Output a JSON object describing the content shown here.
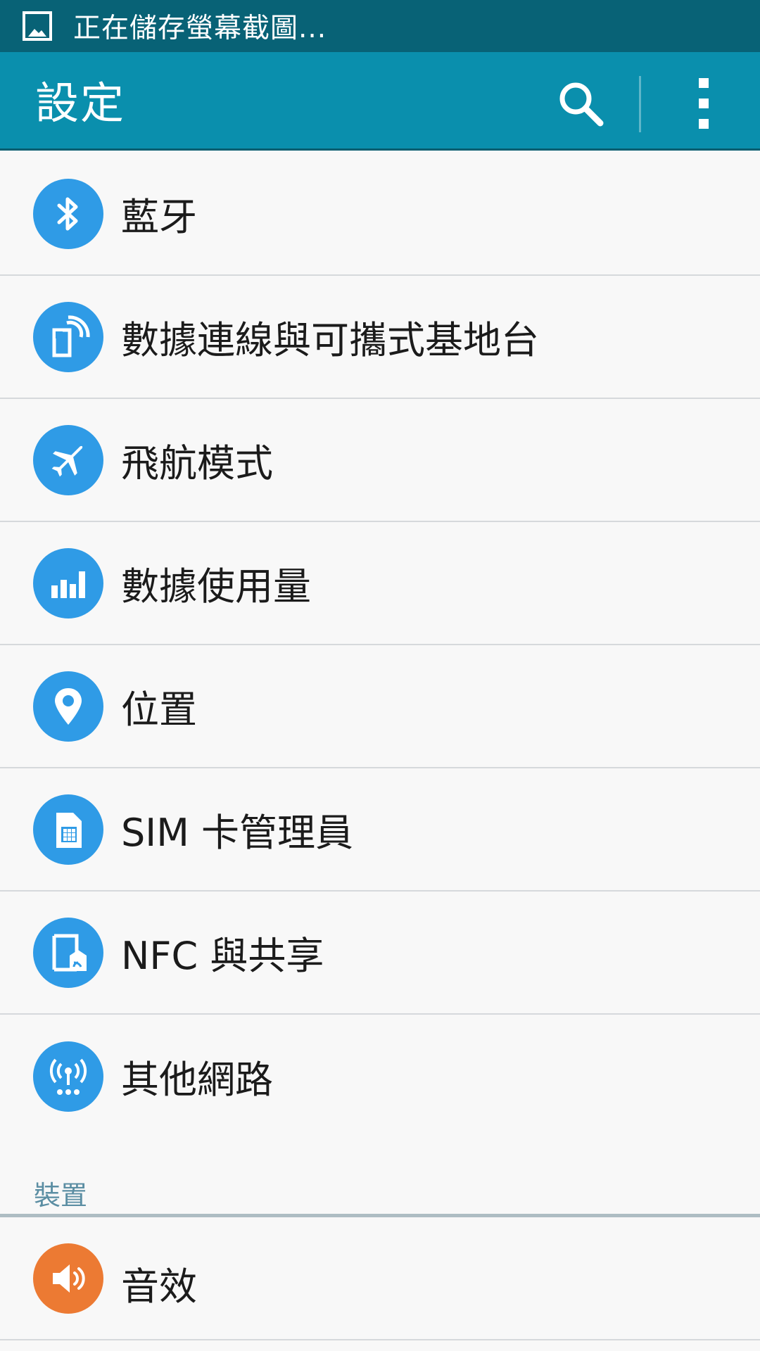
{
  "status_bar": {
    "notification_text": "正在儲存螢幕截圖..."
  },
  "app_bar": {
    "title": "設定",
    "search_icon": "search-icon",
    "menu_icon": "overflow-menu-icon"
  },
  "connections": {
    "items": [
      {
        "label": "藍牙",
        "icon": "bluetooth-icon"
      },
      {
        "label": "數據連線與可攜式基地台",
        "icon": "tethering-hotspot-icon"
      },
      {
        "label": "飛航模式",
        "icon": "airplane-icon"
      },
      {
        "label": "數據使用量",
        "icon": "data-usage-icon"
      },
      {
        "label": "位置",
        "icon": "location-pin-icon"
      },
      {
        "label": "SIM 卡管理員",
        "icon": "sim-card-icon"
      },
      {
        "label": "NFC 與共享",
        "icon": "nfc-share-icon"
      },
      {
        "label": "其他網路",
        "icon": "more-networks-icon"
      }
    ]
  },
  "device_section": {
    "header": "裝置",
    "items": [
      {
        "label": "音效",
        "icon": "speaker-icon"
      }
    ]
  },
  "colors": {
    "status_bar": "#086276",
    "app_bar": "#0a8fad",
    "icon_blue": "#2f9be6",
    "icon_orange": "#ec7a33",
    "section_header_text": "#5b8ea3",
    "background": "#f8f8f8"
  }
}
